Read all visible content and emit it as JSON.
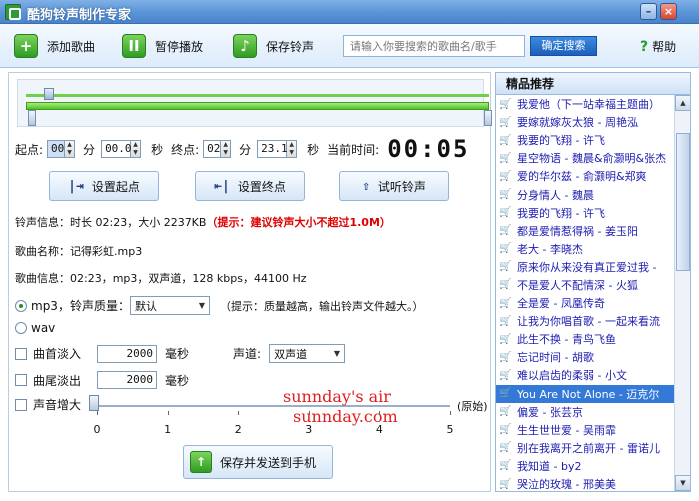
{
  "window": {
    "title": "酷狗铃声制作专家"
  },
  "toolbar": {
    "add_song": "添加歌曲",
    "pause": "暂停播放",
    "save_ringtone": "保存铃声",
    "search_placeholder": "请输入你要搜索的歌曲名/歌手",
    "search_button": "确定搜索",
    "help": "帮助"
  },
  "editor": {
    "start_label": "起点:",
    "start_min": "00",
    "min_unit": "分",
    "start_sec": "00.0",
    "sec_unit": "秒",
    "end_label": "终点:",
    "end_min": "02",
    "end_sec": "23.1",
    "current_time_label": "当前时间:",
    "current_time": "00:05",
    "set_start": "设置起点",
    "set_end": "设置终点",
    "preview": "试听铃声",
    "ringtone_info": "铃声信息：时长 02:23，大小 2237KB",
    "ringtone_warning": "（提示：建议铃声大小不超过1.0M）",
    "song_name": "歌曲名称：记得彩虹.mp3",
    "song_info": "歌曲信息：02:23，mp3，双声道，128 kbps，44100 Hz",
    "format_mp3": "mp3",
    "quality_label": "，铃声质量：",
    "quality_value": "默认",
    "quality_hint": "（提示：质量越高，输出铃声文件越大。）",
    "format_wav": "wav",
    "fade_in": "曲首淡入",
    "fade_in_value": "2000",
    "ms_unit": "毫秒",
    "channel_label": "声道:",
    "channel_value": "双声道",
    "fade_out": "曲尾淡出",
    "fade_out_value": "2000",
    "volume_boost": "声音增大",
    "volume_original": "(原始)",
    "volume_ticks": [
      "0",
      "1",
      "2",
      "3",
      "4",
      "5"
    ],
    "volume_level": 0,
    "save_send": "保存并发送到手机"
  },
  "watermark": {
    "line1": "sunnday's air",
    "line2": "sunnday.com"
  },
  "recommend": {
    "title": "精品推荐",
    "items": [
      "我爱他（下一站幸福主题曲）",
      "要嫁就嫁灰太狼 - 周艳泓",
      "我要的飞翔 - 许飞",
      "星空物语 - 魏晨&俞灏明&张杰",
      "爱的华尔兹 - 俞灏明&郑爽",
      "分身情人 - 魏晨",
      "我要的飞翔 - 许飞",
      "都是爱情惹得祸 - 姜玉阳",
      "老大 - 李晓杰",
      "原来你从来没有真正爱过我 - ",
      "不是爱人不配情深 - 火狐",
      "全是爱 - 凤凰传奇",
      "让我为你唱首歌 - 一起来看流",
      "此生不换 - 青鸟飞鱼",
      "忘记时间 - 胡歌",
      "难以启齿的柔弱 - 小文",
      "You Are Not Alone - 迈克尔",
      "偏爱 - 张芸京",
      "生生世世爱 - 吴雨霏",
      "别在我离开之前离开 - 雷诺儿",
      "我知道 - by2",
      "哭泣的玫瑰 - 邢美美"
    ]
  }
}
